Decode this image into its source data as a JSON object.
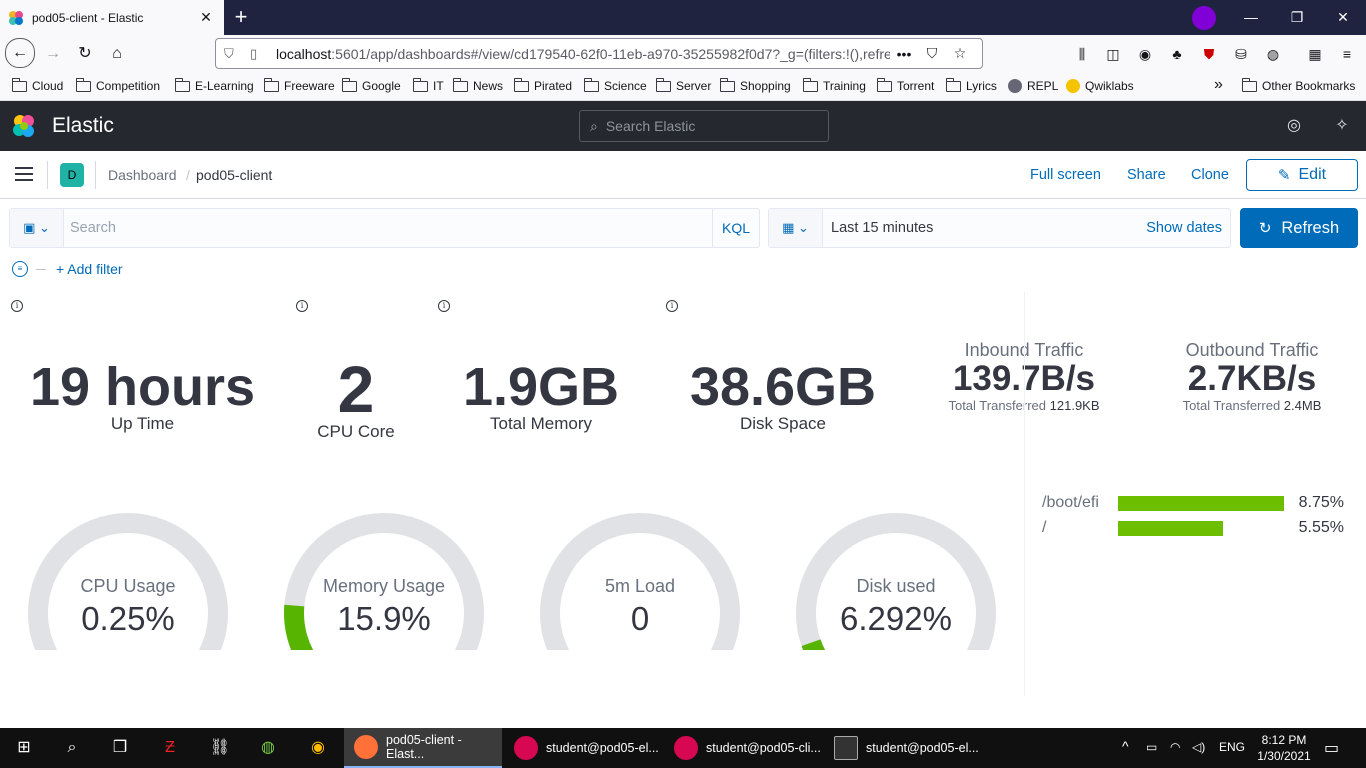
{
  "browser": {
    "tab_title": "pod05-client - Elastic",
    "tab_close": "✕",
    "new_tab": "+",
    "url_host": "localhost",
    "url_path": ":5601/app/dashboards#/view/cd179540-62f0-11eb-a970-35255982f0d7?_g=(filters:!(),refre",
    "url_more": "•••",
    "bookmarks": [
      "Cloud",
      "Competition",
      "E-Learning",
      "Freeware",
      "Google",
      "IT",
      "News",
      "Pirated",
      "Science",
      "Server",
      "Shopping",
      "Training",
      "Torrent",
      "Lyrics",
      "REPL",
      "Qwiklabs"
    ],
    "other_bookmarks": "Other Bookmarks",
    "overflow": "»"
  },
  "kibana": {
    "app_name": "Elastic",
    "search_placeholder": "Search Elastic",
    "space_initial": "D",
    "breadcrumb_parent": "Dashboard",
    "breadcrumb_current": "pod05-client",
    "full_screen": "Full screen",
    "share": "Share",
    "clone": "Clone",
    "edit": "Edit",
    "query_placeholder": "Search",
    "kql": "KQL",
    "time_range": "Last 15 minutes",
    "show_dates": "Show dates",
    "refresh": "Refresh",
    "add_filter": "+ Add filter"
  },
  "metrics": {
    "uptime": {
      "value": "19 hours",
      "label": "Up Time"
    },
    "cpu_core": {
      "value": "2",
      "label": "CPU Core"
    },
    "total_memory": {
      "value": "1.9GB",
      "label": "Total Memory"
    },
    "disk_space": {
      "value": "38.6GB",
      "label": "Disk Space"
    },
    "inbound": {
      "title": "Inbound Traffic",
      "value": "139.7B/s",
      "sub_label": "Total Transferred",
      "sub_value": "121.9KB"
    },
    "outbound": {
      "title": "Outbound Traffic",
      "value": "2.7KB/s",
      "sub_label": "Total Transferred",
      "sub_value": "2.4MB"
    }
  },
  "gauges": [
    {
      "label": "CPU Usage",
      "value": "0.25%",
      "fraction": 0.0025
    },
    {
      "label": "Memory Usage",
      "value": "15.9%",
      "fraction": 0.159
    },
    {
      "label": "5m Load",
      "value": "0",
      "fraction": 0
    },
    {
      "label": "Disk used",
      "value": "6.292%",
      "fraction": 0.06292
    }
  ],
  "filesystems": [
    {
      "name": "/boot/efi",
      "pct": "8.75%",
      "fraction": 1.0
    },
    {
      "name": "/",
      "pct": "5.55%",
      "fraction": 0.634
    }
  ],
  "colors": {
    "accent": "#006bb8",
    "gauge_fill": "#57b400",
    "gauge_track": "#e0e2e6",
    "bar_fill": "#6cbf00",
    "header_bg": "#25282f"
  },
  "taskbar": {
    "items": [
      "pod05-client - Elast...",
      "student@pod05-el...",
      "student@pod05-cli...",
      "student@pod05-el..."
    ],
    "lang": "ENG",
    "time": "8:12 PM",
    "date": "1/30/2021"
  }
}
